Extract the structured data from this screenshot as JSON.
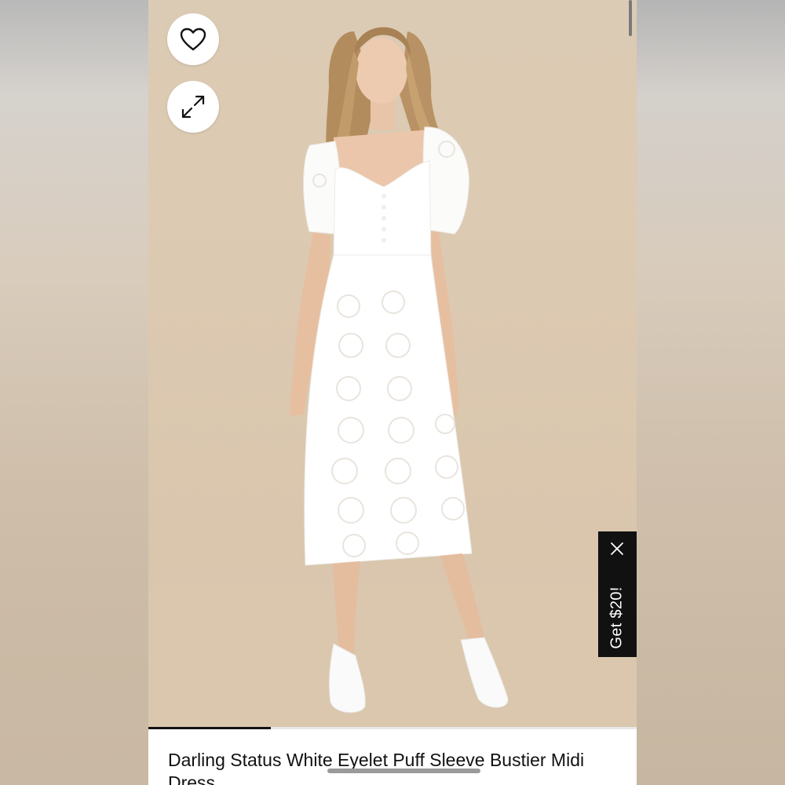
{
  "product": {
    "title": "Darling Status White Eyelet Puff Sleeve Bustier Midi Dress"
  },
  "actions": {
    "favorite_icon": "heart-outline-icon",
    "expand_icon": "expand-arrows-icon"
  },
  "promo": {
    "label": "Get $20!",
    "close_icon": "close-icon"
  },
  "gallery": {
    "progress_fraction": 0.25
  },
  "colors": {
    "image_background": "#dccbb4",
    "promo_background": "#111111",
    "text": "#111111"
  }
}
